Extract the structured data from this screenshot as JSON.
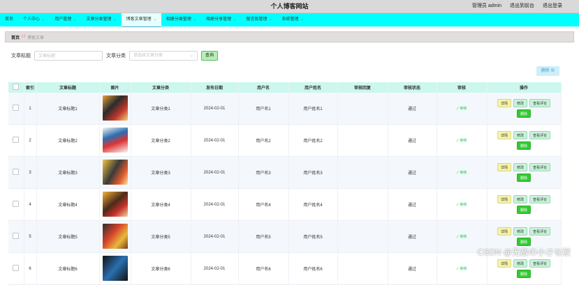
{
  "header": {
    "title": "个人博客网站",
    "user": "管理员 admin",
    "to_frontend": "退出到前台",
    "logout": "退出登录"
  },
  "menu": [
    {
      "label": "首页",
      "has_caret": false,
      "active": false
    },
    {
      "label": "个人中心",
      "has_caret": true,
      "active": false
    },
    {
      "label": "用户管理",
      "has_caret": true,
      "active": false
    },
    {
      "label": "文章分类管理",
      "has_caret": true,
      "active": false
    },
    {
      "label": "博客文章管理",
      "has_caret": true,
      "active": true
    },
    {
      "label": "相册分类管理",
      "has_caret": true,
      "active": false
    },
    {
      "label": "相册分享管理",
      "has_caret": true,
      "active": false
    },
    {
      "label": "留言板管理",
      "has_caret": true,
      "active": false
    },
    {
      "label": "系统管理",
      "has_caret": true,
      "active": false
    }
  ],
  "breadcrumb": {
    "home": "首页",
    "separator": "/ /",
    "current": "博客文章"
  },
  "search": {
    "title_label": "文章标题",
    "title_placeholder": "文章标题",
    "category_label": "文章分类",
    "category_placeholder": "请选择文章分类",
    "button": "查询"
  },
  "batch_delete": "删除 ⊗",
  "table": {
    "columns": [
      "",
      "索引",
      "文章标题",
      "图片",
      "文章分类",
      "发布日期",
      "用户名",
      "用户姓名",
      "审核回复",
      "审核状态",
      "审核",
      "操作"
    ],
    "rows": [
      {
        "index": "1",
        "title": "文章标题1",
        "category": "文章分类1",
        "date": "2024-02-01",
        "username": "用户名1",
        "realname": "用户姓名1",
        "reply": "",
        "status": "通过",
        "audit": "✓ 审核",
        "link": true
      },
      {
        "index": "2",
        "title": "文章标题2",
        "category": "文章分类2",
        "date": "2024-02-01",
        "username": "用户名2",
        "realname": "用户姓名2",
        "reply": "",
        "status": "通过",
        "audit": "✓ 审核",
        "link": false
      },
      {
        "index": "3",
        "title": "文章标题3",
        "category": "文章分类3",
        "date": "2024-02-01",
        "username": "用户名3",
        "realname": "用户姓名3",
        "reply": "",
        "status": "通过",
        "audit": "✓ 审核",
        "link": true
      },
      {
        "index": "4",
        "title": "文章标题4",
        "category": "文章分类4",
        "date": "2024-02-01",
        "username": "用户名4",
        "realname": "用户姓名4",
        "reply": "",
        "status": "通过",
        "audit": "✓ 审核",
        "link": false
      },
      {
        "index": "5",
        "title": "文章标题5",
        "category": "文章分类5",
        "date": "2024-02-01",
        "username": "用户名5",
        "realname": "用户姓名5",
        "reply": "",
        "status": "通过",
        "audit": "✓ 审核",
        "link": true
      },
      {
        "index": "6",
        "title": "文章标题6",
        "category": "文章分类6",
        "date": "2024-02-01",
        "username": "用户名6",
        "realname": "用户姓名6",
        "reply": "",
        "status": "通过",
        "audit": "✓ 审核",
        "link": false
      }
    ],
    "actions": {
      "detail": "详情",
      "edit": "修改",
      "comments": "查看评论",
      "delete": "删除"
    }
  },
  "watermark": "CSDN @无敌の小さな鮫",
  "colors": {
    "menu_bg": "#00ffff",
    "header_bg": "#d9d9d9",
    "table_header_bg": "#ccf7ee",
    "link": "#409eff",
    "delete_button": "#35c935"
  }
}
